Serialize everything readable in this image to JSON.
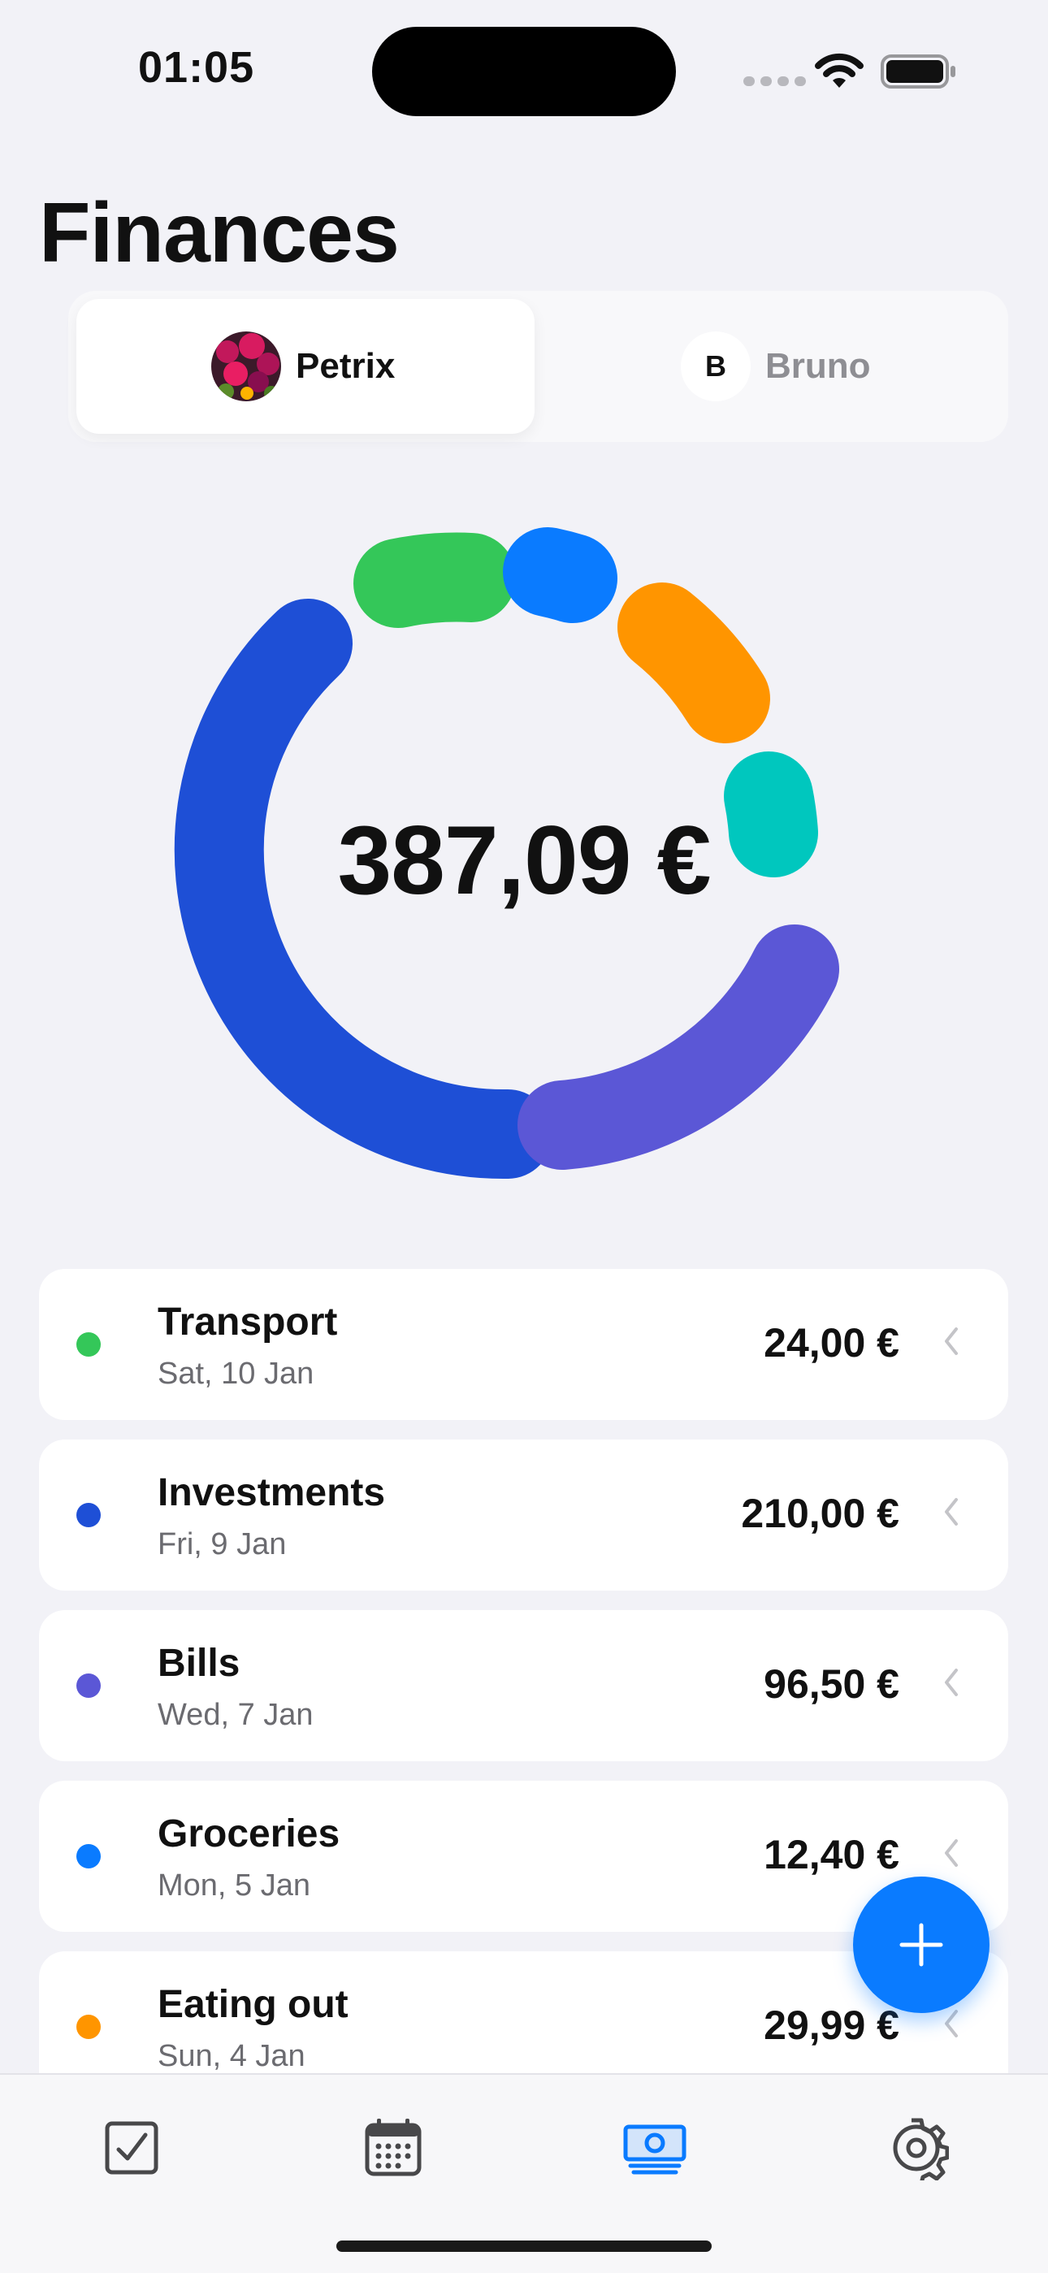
{
  "status_bar": {
    "time": "01:05"
  },
  "page": {
    "title": "Finances"
  },
  "segmented": {
    "users": [
      {
        "name": "Petrix",
        "selected": true
      },
      {
        "name": "Bruno",
        "initial": "B",
        "selected": false
      }
    ]
  },
  "summary": {
    "total": "387,09 €"
  },
  "colors": {
    "transport": "#34c759",
    "investments": "#1e4fd6",
    "bills": "#5b57d6",
    "groceries": "#0a7bff",
    "eating_out": "#ff9500",
    "teal_category": "#00c7be",
    "accent": "#0a7bff"
  },
  "transactions": [
    {
      "title": "Transport",
      "date": "Sat, 10 Jan",
      "amount": "24,00 €",
      "color": "#34c759"
    },
    {
      "title": "Investments",
      "date": "Fri, 9 Jan",
      "amount": "210,00 €",
      "color": "#1e4fd6"
    },
    {
      "title": "Bills",
      "date": "Wed, 7 Jan",
      "amount": "96,50 €",
      "color": "#5b57d6"
    },
    {
      "title": "Groceries",
      "date": "Mon, 5 Jan",
      "amount": "12,40 €",
      "color": "#0a7bff"
    },
    {
      "title": "Eating out",
      "date": "Sun, 4 Jan",
      "amount": "29,99 €",
      "color": "#ff9500"
    }
  ],
  "tabbar": {
    "tabs": [
      {
        "icon": "checkbox-icon",
        "active": false
      },
      {
        "icon": "calendar-icon",
        "active": false
      },
      {
        "icon": "money-icon",
        "active": true
      },
      {
        "icon": "gear-icon",
        "active": false
      }
    ]
  },
  "fab": {
    "icon": "plus-icon"
  }
}
